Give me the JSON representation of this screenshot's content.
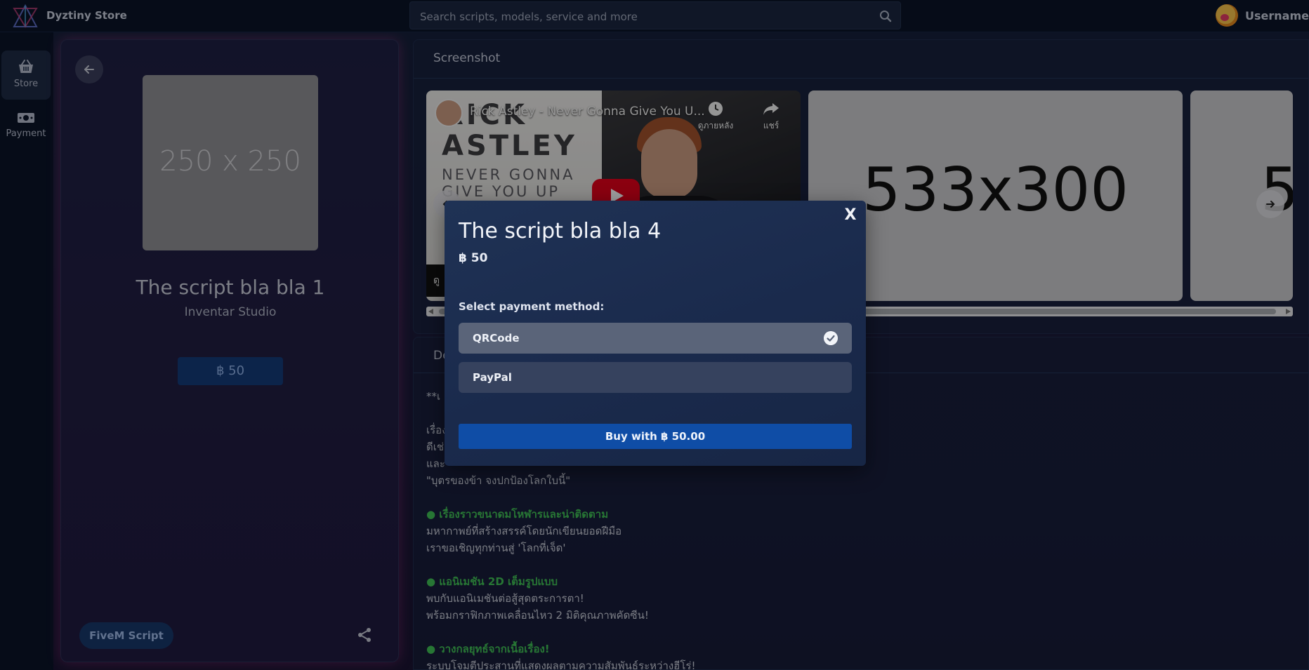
{
  "app": {
    "brand": "Dyztiny Store"
  },
  "search": {
    "placeholder": "Search scripts, models, service and more"
  },
  "user": {
    "name": "Username"
  },
  "rail": {
    "items": [
      {
        "label": "Store",
        "icon": "basket-icon",
        "active": true
      },
      {
        "label": "Payment",
        "icon": "money-icon",
        "active": false
      }
    ]
  },
  "product": {
    "thumb_text": "250 x 250",
    "title": "The script bla bla 1",
    "studio": "Inventar Studio",
    "price": "฿ 50",
    "tag": "FiveM Script"
  },
  "screenshots": {
    "title": "Screenshot",
    "video": {
      "title": "Rick Astley - Never Gonna Give You U...",
      "watch_later": "ดูภายหลัง",
      "share": "แชร์",
      "art_line1": "RICK",
      "art_line2": "ASTLEY",
      "art_line3": "NEVER GONNA",
      "art_line4": "GIVE YOU UP",
      "bottom_text": "ดู"
    },
    "slide2_text": "533x300",
    "slide3_text": "5"
  },
  "description": {
    "title": "De",
    "lines": [
      {
        "text": "**เ",
        "type": "text"
      },
      {
        "text": "",
        "type": "gap"
      },
      {
        "text": "เรื่อง",
        "type": "text"
      },
      {
        "text": "ดีเช่",
        "type": "text"
      },
      {
        "text": "และ",
        "type": "text"
      },
      {
        "text": "\"บุตรของข้า จงปกป้องโลกใบนี้\"",
        "type": "text"
      },
      {
        "text": "",
        "type": "gap"
      },
      {
        "text": "● เรื่องราวขนาดมโหฬารและน่าติดตาม",
        "type": "heading"
      },
      {
        "text": "มหากาพย์ที่สร้างสรรค์โดยนักเขียนยอดฝีมือ",
        "type": "text"
      },
      {
        "text": "เราขอเชิญทุกท่านสู่ 'โลกที่เจ็ด'",
        "type": "text"
      },
      {
        "text": "",
        "type": "gap"
      },
      {
        "text": "● แอนิเมชัน 2D เต็มรูปแบบ",
        "type": "heading"
      },
      {
        "text": "พบกับแอนิเมชันต่อสู้สุดตระการตา!",
        "type": "text"
      },
      {
        "text": "พร้อมกราฟิกภาพเคลื่อนไหว 2 มิติคุณภาพคัดซีน!",
        "type": "text"
      },
      {
        "text": "",
        "type": "gap"
      },
      {
        "text": "● วางกลยุทธ์จากเนื้อเรื่อง!",
        "type": "heading"
      },
      {
        "text": "ระบบโจมตีประสานที่แสดงผลตามความสัมพันธ์ระหว่างฮีโร่!",
        "type": "text"
      }
    ]
  },
  "modal": {
    "close": "X",
    "title": "The script bla bla 4",
    "price": "฿ 50",
    "select_label": "Select payment method:",
    "options": [
      {
        "label": "QRCode",
        "selected": true
      },
      {
        "label": "PayPal",
        "selected": false
      }
    ],
    "buy_label": "Buy with ฿ 50.00"
  },
  "colors": {
    "accent": "#0f4da6",
    "heading_green": "#3fbf55",
    "card_glow": "#cd3a9b"
  }
}
